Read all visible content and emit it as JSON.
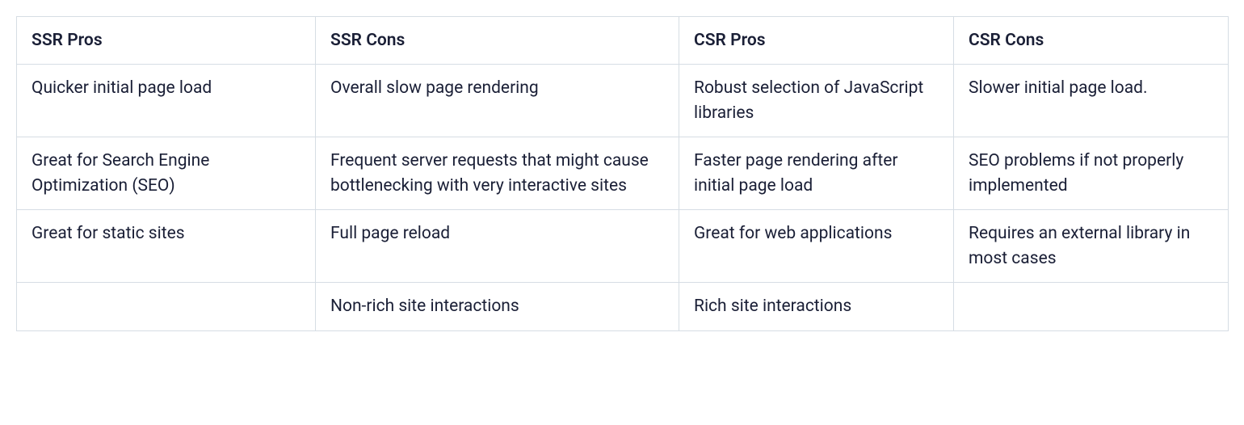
{
  "chart_data": {
    "type": "table",
    "headers": [
      "SSR Pros",
      "SSR Cons",
      "CSR Pros",
      "CSR Cons"
    ],
    "rows": [
      [
        "Quicker initial page load",
        "Overall slow page rendering",
        "Robust selection of JavaScript libraries",
        "Slower initial page load."
      ],
      [
        "Great for Search Engine Optimization (SEO)",
        "Frequent server requests that might cause bottlenecking with very interactive sites",
        "Faster page rendering after initial page load",
        "SEO problems if not properly implemented"
      ],
      [
        "Great for static sites",
        "Full page reload",
        "Great for web applications",
        "Requires an external library in most cases"
      ],
      [
        "",
        "Non-rich site interactions",
        "Rich site interactions",
        ""
      ]
    ]
  }
}
